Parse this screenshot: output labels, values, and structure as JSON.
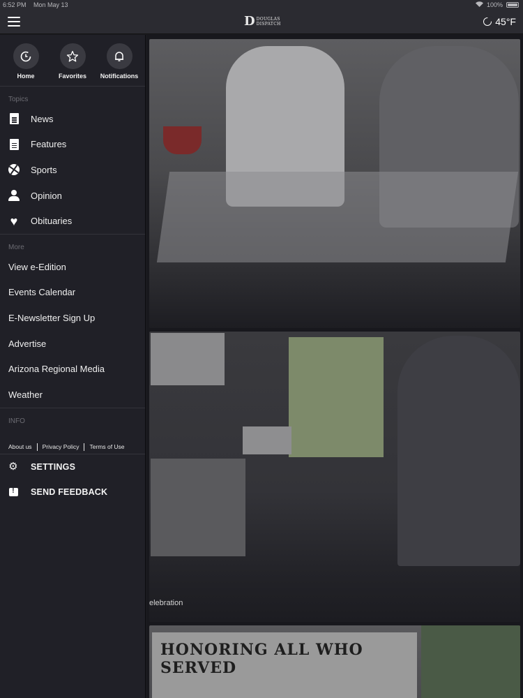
{
  "status_bar": {
    "time": "6:52 PM",
    "date": "Mon May 13",
    "battery": "100%"
  },
  "header": {
    "logo_mark": "D",
    "logo_line1": "DOUGLAS",
    "logo_line2": "DISPATCH",
    "temperature": "45°F"
  },
  "sidebar": {
    "quick_links": [
      {
        "label": "Home",
        "icon": "home-refresh-icon"
      },
      {
        "label": "Favorites",
        "icon": "star-icon"
      },
      {
        "label": "Notifications",
        "icon": "bell-icon"
      }
    ],
    "topics_heading": "Topics",
    "topics": [
      {
        "label": "News",
        "icon": "document-icon"
      },
      {
        "label": "Features",
        "icon": "document-icon"
      },
      {
        "label": "Sports",
        "icon": "basketball-icon"
      },
      {
        "label": "Opinion",
        "icon": "person-icon"
      },
      {
        "label": "Obituaries",
        "icon": "heart-icon"
      }
    ],
    "more_heading": "More",
    "more": [
      "View e-Edition",
      "Events Calendar",
      "E-Newsletter Sign Up",
      "Advertise",
      "Arizona Regional Media",
      "Weather"
    ],
    "info_heading": "INFO",
    "info_links": [
      "About us",
      "Privacy Policy",
      "Terms of Use"
    ],
    "settings_label": "SETTINGS",
    "feedback_label": "SEND FEEDBACK"
  },
  "content": {
    "card2_caption": "elebration",
    "card3_banner_text": "HONORING ALL WHO SERVED"
  }
}
